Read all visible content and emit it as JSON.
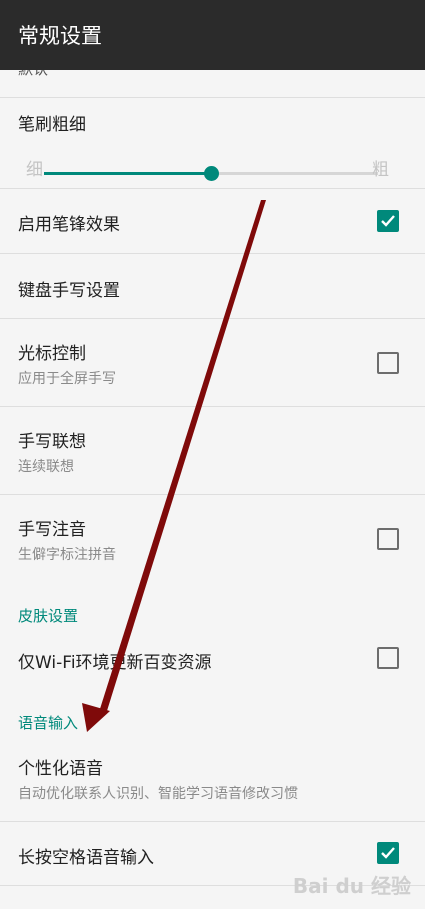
{
  "appbar": {
    "title": "常规设置"
  },
  "clipped_value": "默认",
  "brush": {
    "title": "笔刷粗细",
    "min_label": "细",
    "max_label": "粗",
    "level": 0.5
  },
  "items": [
    {
      "title": "启用笔锋效果",
      "checked": true
    },
    {
      "title": "键盘手写设置"
    },
    {
      "title": "光标控制",
      "subtitle": "应用于全屏手写",
      "checked": false
    },
    {
      "title": "手写联想",
      "subtitle": "连续联想"
    },
    {
      "title": "手写注音",
      "subtitle": "生僻字标注拼音",
      "checked": false
    }
  ],
  "skin_section": {
    "header": "皮肤设置",
    "item": {
      "title": "仅Wi-Fi环境更新百变资源",
      "checked": false
    }
  },
  "voice_section": {
    "header": "语音输入",
    "personal": {
      "title": "个性化语音",
      "subtitle": "自动优化联系人识别、智能学习语音修改习惯"
    },
    "longpress": {
      "title": "长按空格语音输入",
      "checked": true
    }
  },
  "watermark": "Bai du 经验",
  "colors": {
    "accent": "#00897b",
    "appbar": "#2b2b2b",
    "arrow": "#7f0a0a"
  }
}
